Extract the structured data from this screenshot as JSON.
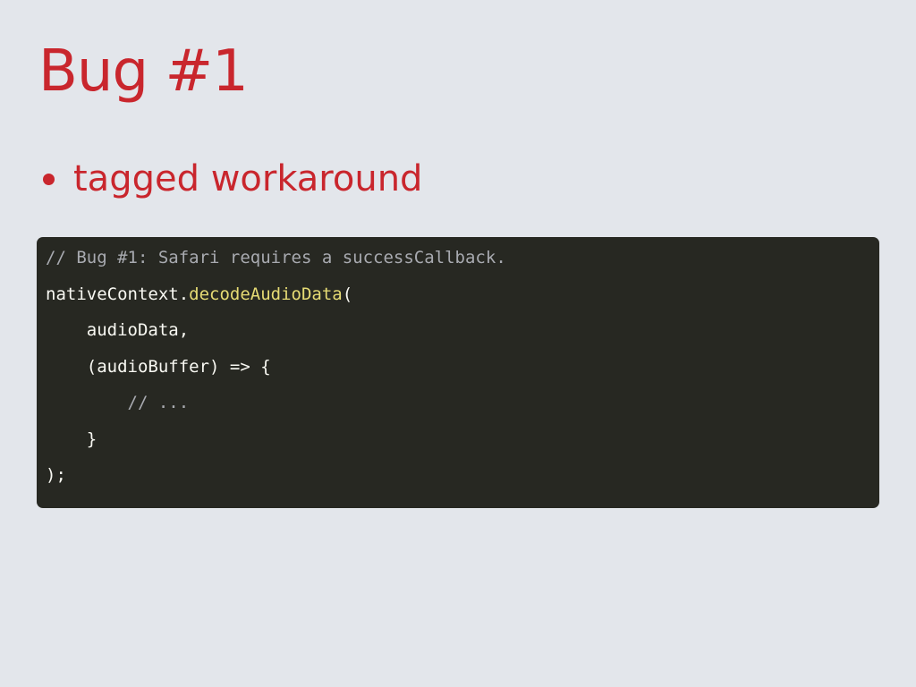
{
  "slide": {
    "title": "Bug #1",
    "bullets": [
      "tagged workaround"
    ]
  },
  "colors": {
    "background": "#e3e6eb",
    "accent": "#c9262d",
    "code_background": "#272822",
    "code_text": "#f8f8f2",
    "code_comment": "#a8aab0",
    "code_function": "#e6db74"
  },
  "code": {
    "line1": "// Bug #1: Safari requires a successCallback.",
    "line2_object": "nativeContext.",
    "line2_method": "decodeAudioData",
    "line2_paren": "(",
    "line3": "    audioData,",
    "line4": "    (audioBuffer) => {",
    "line5": "        // ...",
    "line6": "    }",
    "line7": ");"
  }
}
